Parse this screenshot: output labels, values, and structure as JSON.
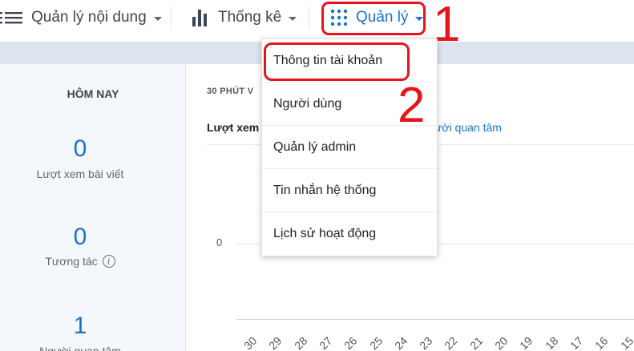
{
  "nav": {
    "items": [
      {
        "label": "Quản lý nội dung",
        "icon": "list-icon"
      },
      {
        "label": "Thống kê",
        "icon": "bar-chart-icon"
      },
      {
        "label": "Quản lý",
        "icon": "grid-icon"
      }
    ]
  },
  "annotations": {
    "step1": "1",
    "step2": "2",
    "color": "#e8141b"
  },
  "dropdown": {
    "items": [
      {
        "label": "Thông tin tài khoản"
      },
      {
        "label": "Người dùng"
      },
      {
        "label": "Quản lý admin"
      },
      {
        "label": "Tin nhắn hệ thống"
      },
      {
        "label": "Lịch sử hoạt động"
      }
    ]
  },
  "stats": {
    "heading": "HÔM NAY",
    "items": [
      {
        "value": "0",
        "label": "Lượt xem bài viết"
      },
      {
        "value": "0",
        "label": "Tương tác"
      },
      {
        "value": "1",
        "label": "Người quan tâm"
      }
    ]
  },
  "chart": {
    "title": "30 PHÚT V",
    "tab_views": "Lượt xem",
    "tab_followers": "ười quan tâm",
    "y_tick": "0",
    "x_ticks": [
      "30",
      "29",
      "28",
      "27",
      "26",
      "25",
      "24",
      "23",
      "22",
      "21",
      "20",
      "19",
      "18",
      "17",
      "16",
      "15"
    ]
  },
  "colors": {
    "accent": "#1a73c8",
    "panel": "#f4f7fb",
    "bar": "#dbe4ef"
  }
}
